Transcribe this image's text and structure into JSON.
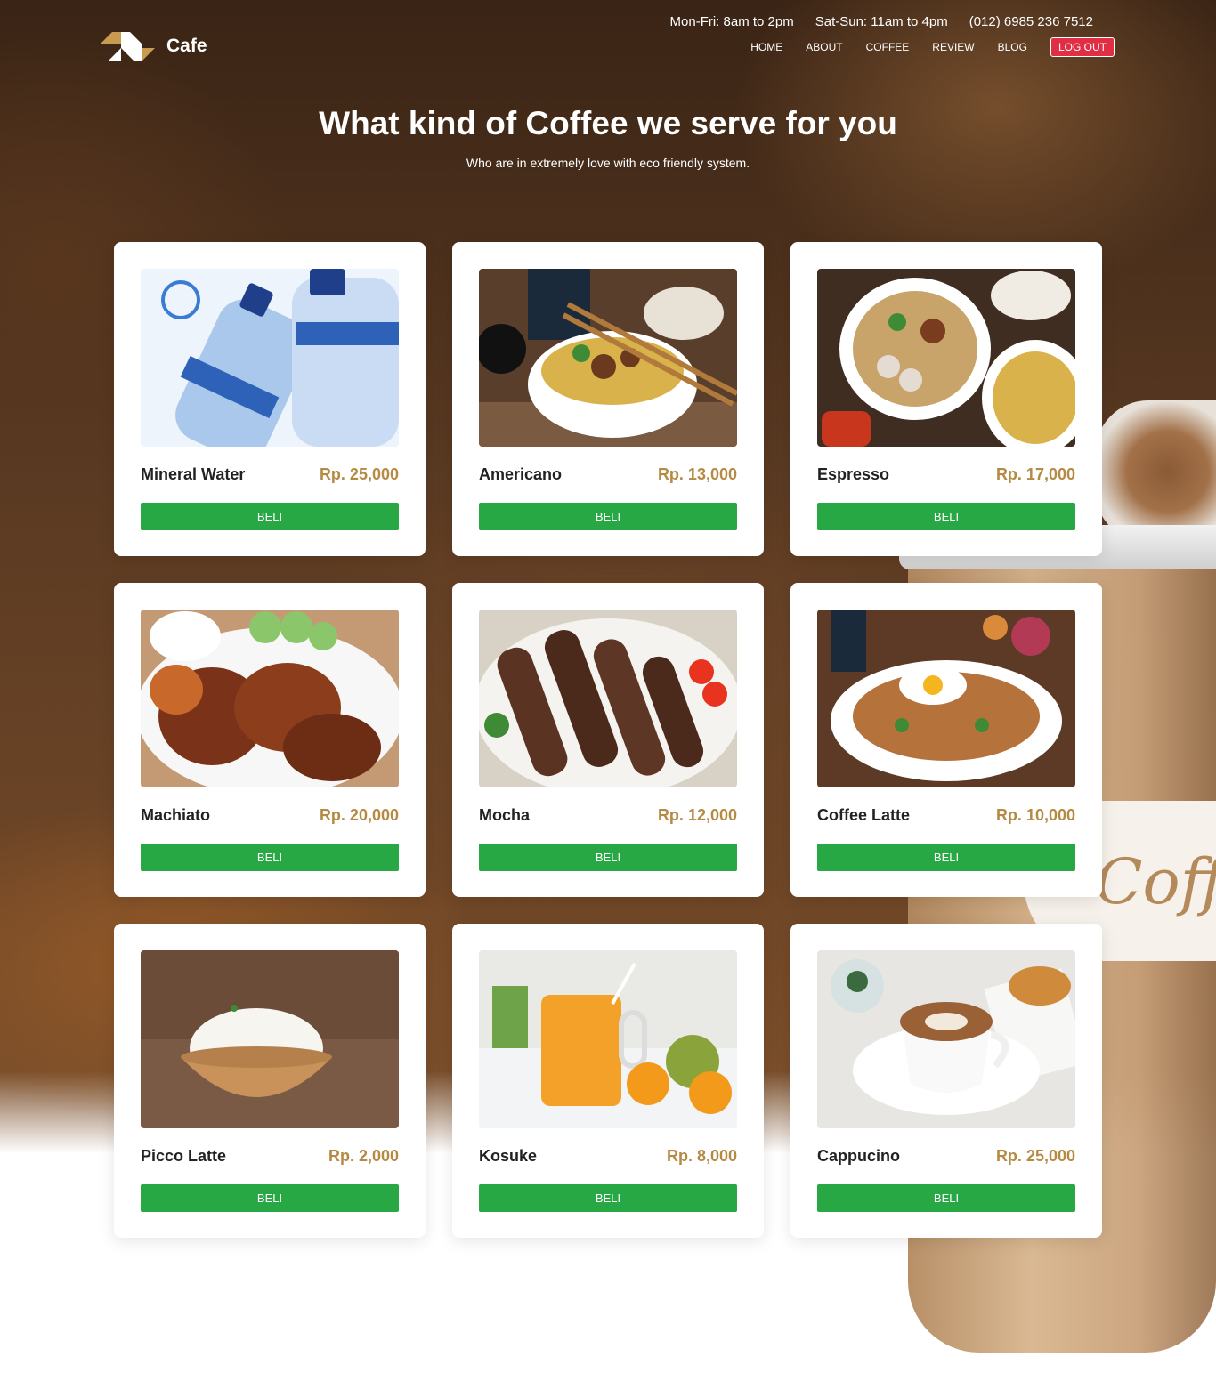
{
  "brand": {
    "name": "Cafe",
    "logo": "stacked-chevron-logo"
  },
  "header": {
    "contact": [
      "Mon-Fri: 8am to 2pm",
      "Sat-Sun: 11am to 4pm",
      "(012) 6985 236 7512"
    ],
    "nav": [
      "HOME",
      "ABOUT",
      "COFFEE",
      "REVIEW",
      "BLOG"
    ],
    "logout_label": "LOG OUT"
  },
  "hero": {
    "title": "What kind of Coffee we serve for you",
    "subtitle": "Who are in extremely love with eco friendly system."
  },
  "products": [
    {
      "name": "Mineral Water",
      "price": "Rp. 25,000",
      "buy_label": "BELI",
      "image": "mineral-water-bottles"
    },
    {
      "name": "Americano",
      "price": "Rp. 13,000",
      "buy_label": "BELI",
      "image": "noodle-bowl-with-chopsticks"
    },
    {
      "name": "Espresso",
      "price": "Rp. 17,000",
      "buy_label": "BELI",
      "image": "meatball-noodle-bowls"
    },
    {
      "name": "Machiato",
      "price": "Rp. 20,000",
      "buy_label": "BELI",
      "image": "grilled-chicken"
    },
    {
      "name": "Mocha",
      "price": "Rp. 12,000",
      "buy_label": "BELI",
      "image": "grilled-fish"
    },
    {
      "name": "Coffee Latte",
      "price": "Rp. 10,000",
      "buy_label": "BELI",
      "image": "fried-noodles-with-egg"
    },
    {
      "name": "Picco Latte",
      "price": "Rp. 2,000",
      "buy_label": "BELI",
      "image": "rice-bowl"
    },
    {
      "name": "Kosuke",
      "price": "Rp. 8,000",
      "buy_label": "BELI",
      "image": "orange-juice-glass"
    },
    {
      "name": "Cappucino",
      "price": "Rp. 25,000",
      "buy_label": "BELI",
      "image": "cappuccino-cup"
    }
  ],
  "colors": {
    "accent_price": "#b58a43",
    "buy_button": "#28a745",
    "logout_button": "#e02f45"
  }
}
